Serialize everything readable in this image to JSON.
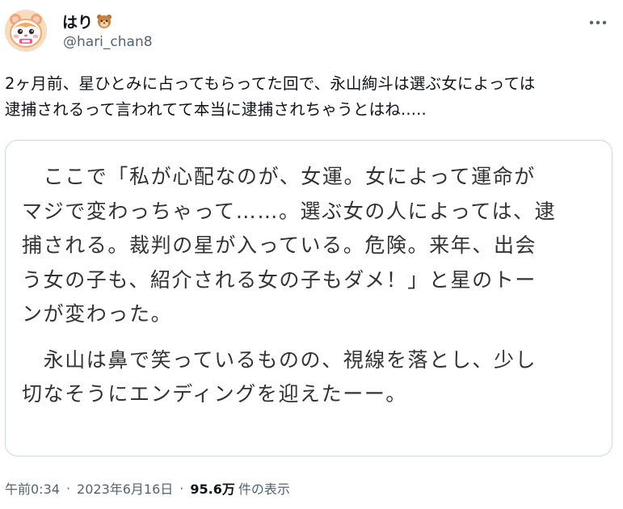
{
  "author": {
    "display_name": "はり",
    "handle": "@hari_chan8",
    "avatar_icon": "hamster-avatar-icon",
    "name_emoji_icon": "hamster-face-emoji"
  },
  "tweet": {
    "text": "2ヶ月前、星ひとみに占ってもらってた回で、永山絢斗は選ぶ女によっては\n逮捕されるって言われてて本当に逮捕されちゃうとはね.....",
    "more_icon": "more-options-icon"
  },
  "quote_image": {
    "paragraph_1": "　ここで「私が心配なのが、女運。女によって運命が\nマジで変わっちゃって……。選ぶ女の人によっては、逮\n捕される。裁判の星が入っている。危険。来年、出会\nう女の子も、紹介される女の子もダメ！」と星のトー\nンが変わった。",
    "paragraph_2": "　永山は鼻で笑っているものの、視線を落とし、少し\n切なそうにエンディングを迎えたーー。"
  },
  "meta": {
    "time": "午前0:34",
    "separator": "·",
    "date": "2023年6月16日",
    "views_count": "95.6万",
    "views_label": "件の表示"
  },
  "colors": {
    "text_primary": "#0f1419",
    "text_secondary": "#536471",
    "border": "#cfd9de",
    "quote_text": "#333333"
  }
}
